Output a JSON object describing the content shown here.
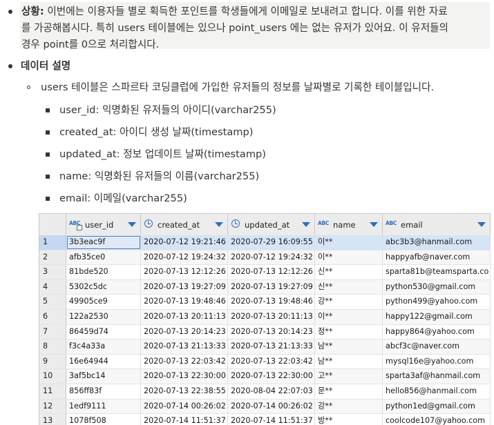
{
  "situation": {
    "label": "상황:",
    "line1": " 이번에는 이용자들 별로 획득한 포인트를 학생들에게 이메일로 보내려고 합니다. 이를 위한 자료",
    "line2": "를 가공해봅시다. 특히 users 테이블에는 있으나 point_users 에는 없는 유저가 있어요. 이 유저들의",
    "line3": "경우 point를 0으로 처리합시다."
  },
  "data_desc": {
    "heading": "데이터 설명",
    "users_desc": "users 테이블은 스파르타 코딩클럽에 가입한 유저들의 정보를 날짜별로 기록한 테이블입니다.",
    "fields": [
      "user_id: 익명화된 유저들의 아이디(varchar255)",
      "created_at: 아이디 생성 날짜(timestamp)",
      "updated_at: 정보 업데이트 날짜(timestamp)",
      "name: 익명화된 유저들의 이름(varchar255)",
      "email: 이메일(varchar255)"
    ]
  },
  "table": {
    "columns": [
      {
        "label": "user_id",
        "type_icon": "abc-type-icon"
      },
      {
        "label": "created_at",
        "type_icon": "clock-type-icon"
      },
      {
        "label": "updated_at",
        "type_icon": "clock-type-icon"
      },
      {
        "label": "name",
        "type_icon": "abc-type-icon"
      },
      {
        "label": "email",
        "type_icon": "abc-type-icon"
      }
    ],
    "type_icon_text": "ABC",
    "accent_color": "#2f6fbf",
    "selected_row_color": "#d5e4f7",
    "rows": [
      {
        "n": "1",
        "user_id": "3b3eac9f",
        "created_at": "2020-07-12 19:21:46",
        "updated_at": "2020-07-29 16:09:55",
        "name": "이**",
        "email": "abc3b3@hanmail.com"
      },
      {
        "n": "2",
        "user_id": "afb35ce0",
        "created_at": "2020-07-12 19:24:32",
        "updated_at": "2020-07-12 19:24:32",
        "name": "이**",
        "email": "happyafb@naver.com"
      },
      {
        "n": "3",
        "user_id": "81bde520",
        "created_at": "2020-07-13 12:12:26",
        "updated_at": "2020-07-13 12:12:26",
        "name": "신**",
        "email": "sparta81b@teamsparta.co"
      },
      {
        "n": "4",
        "user_id": "5302c5dc",
        "created_at": "2020-07-13 19:27:09",
        "updated_at": "2020-07-13 19:27:09",
        "name": "신**",
        "email": "python530@gmail.com"
      },
      {
        "n": "5",
        "user_id": "49905ce9",
        "created_at": "2020-07-13 19:48:46",
        "updated_at": "2020-07-13 19:48:46",
        "name": "강**",
        "email": "python499@yahoo.com"
      },
      {
        "n": "6",
        "user_id": "122a2530",
        "created_at": "2020-07-13 20:11:13",
        "updated_at": "2020-07-13 20:11:13",
        "name": "이**",
        "email": "happy122@gmail.com"
      },
      {
        "n": "7",
        "user_id": "86459d74",
        "created_at": "2020-07-13 20:14:23",
        "updated_at": "2020-07-13 20:14:23",
        "name": "정**",
        "email": "happy864@yahoo.com"
      },
      {
        "n": "8",
        "user_id": "f3c4a33a",
        "created_at": "2020-07-13 21:13:33",
        "updated_at": "2020-07-13 21:13:33",
        "name": "남**",
        "email": "abcf3c@naver.com"
      },
      {
        "n": "9",
        "user_id": "16e64944",
        "created_at": "2020-07-13 22:03:42",
        "updated_at": "2020-07-13 22:03:42",
        "name": "남**",
        "email": "mysql16e@yahoo.com"
      },
      {
        "n": "10",
        "user_id": "3af5bc14",
        "created_at": "2020-07-13 22:30:00",
        "updated_at": "2020-07-13 22:30:00",
        "name": "고**",
        "email": "sparta3af@hanmail.com"
      },
      {
        "n": "11",
        "user_id": "856ff83f",
        "created_at": "2020-07-13 22:38:55",
        "updated_at": "2020-08-04 22:07:03",
        "name": "문**",
        "email": "hello856@hanmail.com"
      },
      {
        "n": "12",
        "user_id": "1edf9111",
        "created_at": "2020-07-14 00:26:02",
        "updated_at": "2020-07-14 00:26:02",
        "name": "강**",
        "email": "python1ed@gmail.com"
      },
      {
        "n": "13",
        "user_id": "1078f508",
        "created_at": "2020-07-14 11:51:37",
        "updated_at": "2020-07-14 11:51:37",
        "name": "방**",
        "email": "coolcode107@yahoo.com"
      }
    ]
  }
}
